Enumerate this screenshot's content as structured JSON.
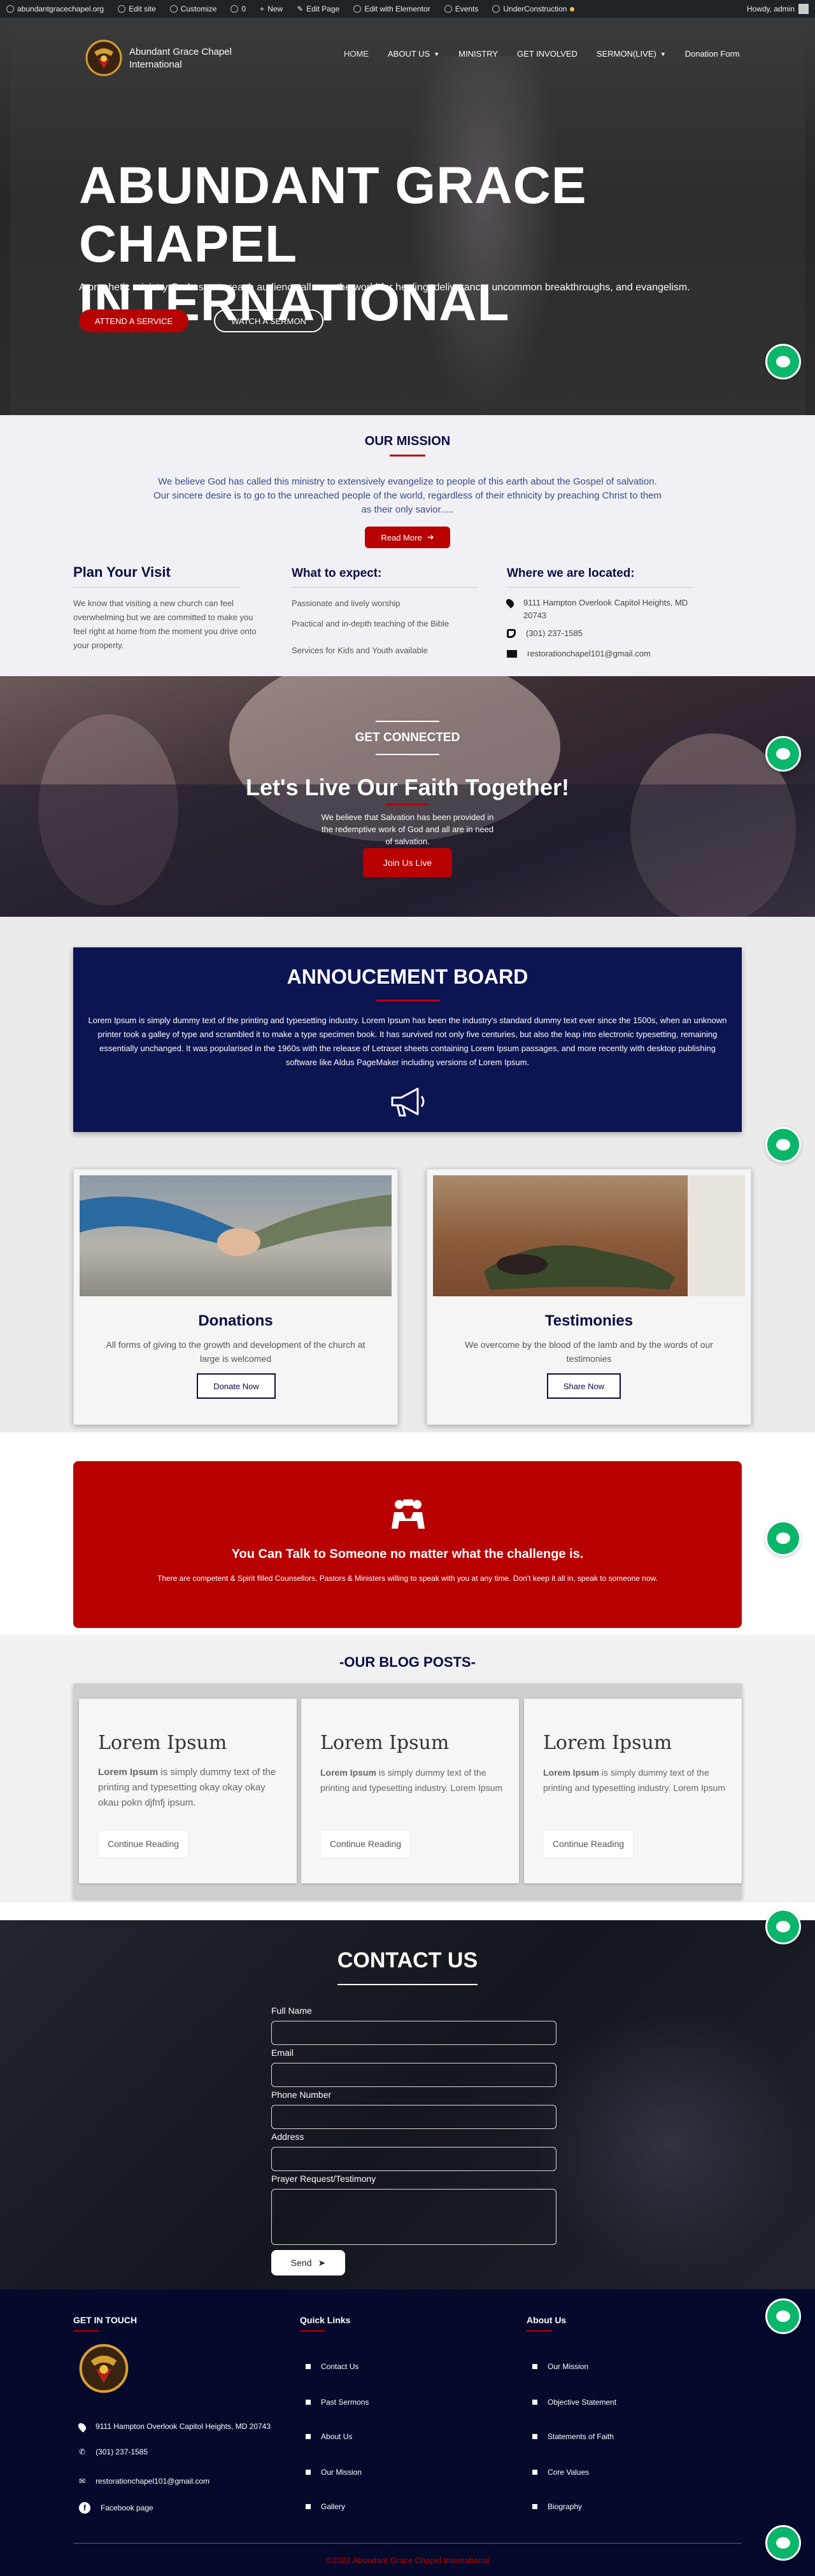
{
  "admin_bar": {
    "site": "abundantgracechapel.org",
    "edit_site": "Edit site",
    "customize": "Customize",
    "comments": "0",
    "new": "New",
    "edit_page": "Edit Page",
    "elementor": "Edit with Elementor",
    "events": "Events",
    "maintenance": "UnderConstruction",
    "howdy": "Howdy, admin"
  },
  "header": {
    "site_name": "Abundant Grace Chapel International",
    "nav": [
      {
        "label": "HOME"
      },
      {
        "label": "ABOUT US"
      },
      {
        "label": "MINISTRY"
      },
      {
        "label": "GET INVOLVED"
      },
      {
        "label": "SERMON(LIVE)"
      },
      {
        "label": "Donation Form"
      }
    ]
  },
  "hero": {
    "title_line1": "ABUNDANT GRACE CHAPEL",
    "title_line2": "INTERNATIONAL",
    "tagline": "A prophetic ministry God uses to reach audience all over the world for healing, deliverance, uncommon breakthroughs, and evangelism.",
    "btn_service": "ATTEND A SERVICE",
    "btn_sermon": "WATCH A SERMON"
  },
  "mission": {
    "title": "OUR MISSION",
    "text": "We believe God has called this ministry to extensively evangelize to people of this earth about the Gospel of salvation. Our sincere desire is to go to the unreached people of the world, regardless of their ethnicity by preaching Christ to them as their only savior.....",
    "read_more": "Read More",
    "plan_title": "Plan Your Visit",
    "plan_text": "We know that visiting a new church can feel overwhelming but we are committed to make you feel right at home from the moment you drive onto your property.",
    "expect_title": "What to expect:",
    "expect_items": [
      "Passionate and lively worship",
      "Practical and in-depth teaching of the Bible",
      "Services for Kids and Youth available"
    ],
    "located_title": "Where we are located:",
    "address": "9111 Hampton Overlook Capitol Heights, MD 20743",
    "phone": "(301) 237-1585",
    "email": "restorationchapel101@gmail.com"
  },
  "connected": {
    "kicker": "GET CONNECTED",
    "title": "Let's Live Our Faith Together!",
    "text": "We believe that Salvation has been provided in the redemptive work of God and all are in need of salvation.",
    "btn": "Join Us Live"
  },
  "announcement": {
    "title": "ANNOUCEMENT BOARD",
    "text": "Lorem Ipsum is simply dummy text of the printing and typesetting industry. Lorem Ipsum has been the industry's standard dummy text ever since the 1500s, when an unknown printer took a galley of type and scrambled it to make a type specimen book. It has survived not only five centuries, but also the leap into electronic typesetting, remaining essentially unchanged. It was popularised in the 1960s with the release of Letraset sheets containing Lorem Ipsum passages, and more recently with desktop publishing software like Aldus PageMaker including versions of Lorem Ipsum."
  },
  "cards": [
    {
      "title": "Donations",
      "text": "All forms of giving to the growth and development of the church at large is welcomed",
      "btn": "Donate Now"
    },
    {
      "title": "Testimonies",
      "text": "We overcome by the blood of the lamb and by the words of our testimonies",
      "btn": "Share Now"
    }
  ],
  "talk": {
    "title": "You Can Talk to Someone no matter what the challenge is.",
    "text": "There are competent & Spirit filled Counsellors, Pastors & Ministers willing to speak with you at any time. Don't keep it all in, speak to someone now."
  },
  "blog": {
    "title": "-OUR BLOG POSTS-",
    "posts": [
      {
        "title": "Lorem Ipsum",
        "bold": "Lorem Ipsum",
        "text": " is simply dummy text of the printing and typesetting okay okay okay okau pokn djfnfj ipsum.",
        "btn": "Continue Reading"
      },
      {
        "title": "Lorem Ipsum",
        "bold": "Lorem Ipsum",
        "text": " is simply dummy text of the printing and typesetting industry. Lorem Ipsum",
        "btn": "Continue Reading"
      },
      {
        "title": "Lorem Ipsum",
        "bold": "Lorem Ipsum",
        "text": " is simply dummy text of the printing and typesetting industry. Lorem Ipsum",
        "btn": "Continue Reading"
      }
    ]
  },
  "contact": {
    "title": "CONTACT US",
    "labels": [
      "Full Name",
      "Email",
      "Phone Number",
      "Address",
      "Prayer Request/Testimony"
    ],
    "send": "Send"
  },
  "footer": {
    "touch_title": "GET IN TOUCH",
    "address": "9111 Hampton Overlook Capitol Heights, MD 20743",
    "phone": "(301) 237-1585",
    "email": "restorationchapel101@gmail.com",
    "facebook": "Facebook page",
    "links_title": "Quick Links",
    "links": [
      "Contact Us",
      "Past Sermons",
      "About Us",
      "Our Mission",
      "Gallery"
    ],
    "about_title": "About Us",
    "about_links": [
      "Our Mission",
      "Objective Statement",
      "Statements of Faith",
      "Core Values",
      "Biography"
    ],
    "copyright": "©2022 Abundant Grace Chapel International"
  },
  "colors": {
    "brand_red": "#b80000",
    "navy": "#0d1452",
    "chat_green": "#0bb56a"
  }
}
